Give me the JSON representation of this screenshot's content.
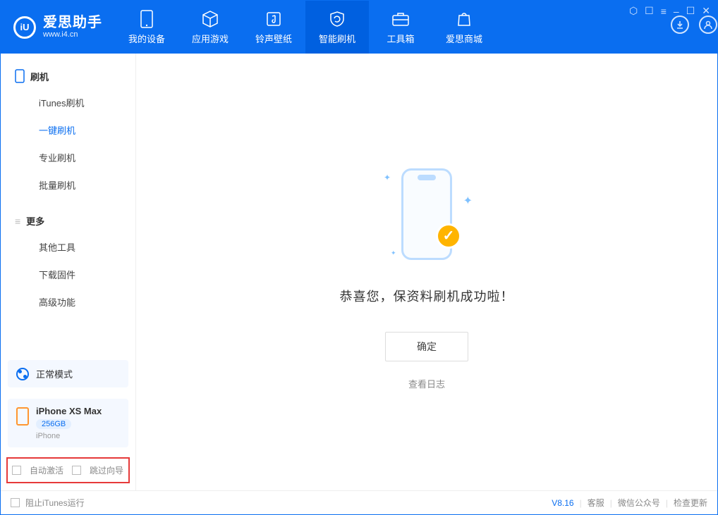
{
  "app": {
    "name": "爱思助手",
    "url": "www.i4.cn"
  },
  "nav": {
    "tabs": [
      {
        "label": "我的设备"
      },
      {
        "label": "应用游戏"
      },
      {
        "label": "铃声壁纸"
      },
      {
        "label": "智能刷机"
      },
      {
        "label": "工具箱"
      },
      {
        "label": "爱思商城"
      }
    ],
    "active_index": 3
  },
  "sidebar": {
    "group1_label": "刷机",
    "items1": [
      "iTunes刷机",
      "一键刷机",
      "专业刷机",
      "批量刷机"
    ],
    "active_item1": 1,
    "group2_label": "更多",
    "items2": [
      "其他工具",
      "下载固件",
      "高级功能"
    ]
  },
  "mode": {
    "label": "正常模式"
  },
  "device": {
    "name": "iPhone XS Max",
    "capacity": "256GB",
    "type": "iPhone"
  },
  "options": {
    "auto_activate": "自动激活",
    "skip_wizard": "跳过向导"
  },
  "main": {
    "success_msg": "恭喜您，保资料刷机成功啦！",
    "ok": "确定",
    "view_log": "查看日志"
  },
  "footer": {
    "block_itunes": "阻止iTunes运行",
    "version": "V8.16",
    "cs": "客服",
    "wechat": "微信公众号",
    "update": "检查更新"
  }
}
